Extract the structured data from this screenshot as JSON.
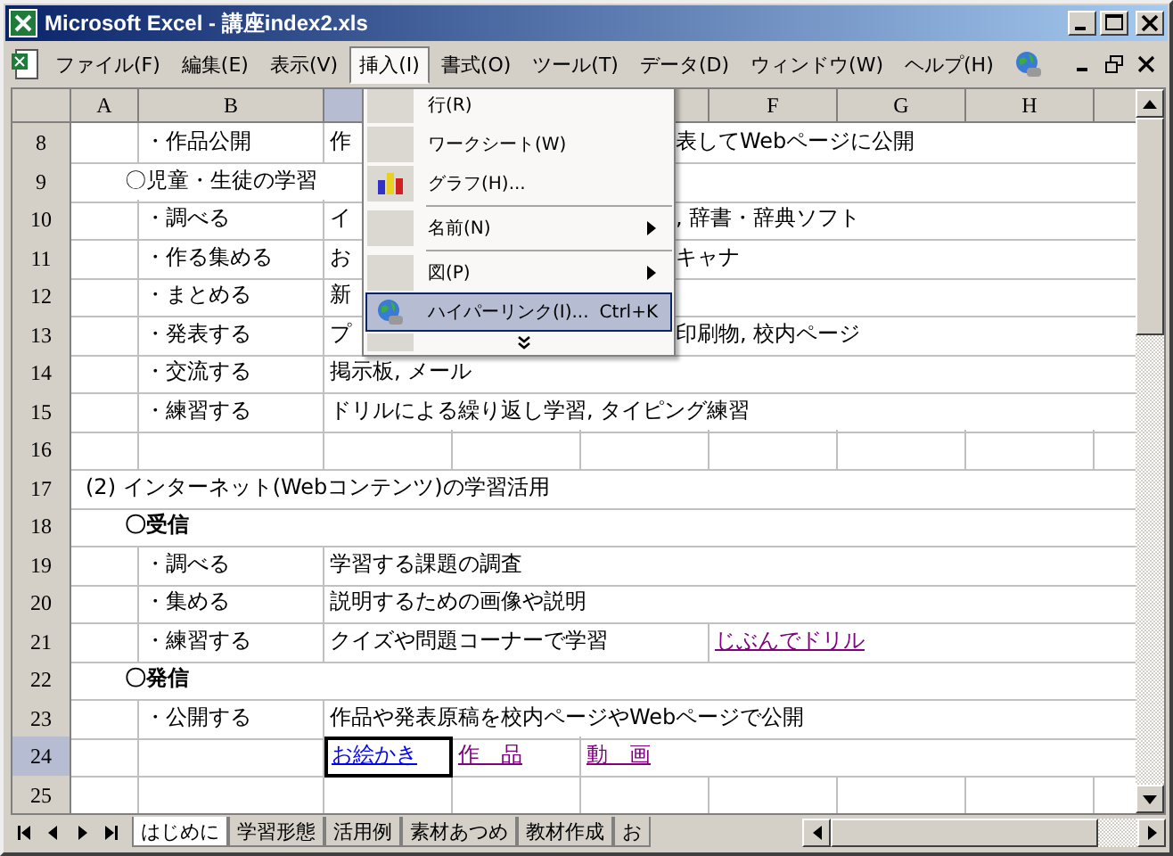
{
  "window": {
    "title": "Microsoft Excel - 講座index2.xls"
  },
  "menu_bar": [
    {
      "label": "ファイル(F)",
      "selected": false
    },
    {
      "label": "編集(E)",
      "selected": false
    },
    {
      "label": "表示(V)",
      "selected": false
    },
    {
      "label": "挿入(I)",
      "selected": true
    },
    {
      "label": "書式(O)",
      "selected": false
    },
    {
      "label": "ツール(T)",
      "selected": false
    },
    {
      "label": "データ(D)",
      "selected": false
    },
    {
      "label": "ウィンドウ(W)",
      "selected": false
    },
    {
      "label": "ヘルプ(H)",
      "selected": false
    }
  ],
  "columns": [
    {
      "label": "A"
    },
    {
      "label": "B"
    },
    {},
    {},
    {},
    {
      "label": "F"
    },
    {
      "label": "G"
    },
    {
      "label": "H"
    }
  ],
  "rows": [
    {
      "num": "8",
      "cells": {
        "b": {
          "kind": "plain",
          "text": "・作品公開"
        },
        "c": {
          "kind": "plain",
          "text": "作"
        },
        "e": {
          "kind": "tail",
          "text": "表してWebページに公開"
        }
      }
    },
    {
      "num": "9",
      "cells": {
        "a": {
          "kind": "heading",
          "bold": false,
          "text": "〇児童・生徒の学習"
        }
      }
    },
    {
      "num": "10",
      "cells": {
        "b": {
          "kind": "plain",
          "text": "・調べる"
        },
        "c": {
          "kind": "plain",
          "text": "イ"
        },
        "e": {
          "kind": "tail",
          "text": ", 辞書・辞典ソフト"
        }
      }
    },
    {
      "num": "11",
      "cells": {
        "b": {
          "kind": "plain",
          "text": "・作る集める"
        },
        "c": {
          "kind": "plain",
          "text": "お"
        },
        "e": {
          "kind": "tail",
          "text": "キャナ"
        }
      }
    },
    {
      "num": "12",
      "cells": {
        "b": {
          "kind": "plain",
          "text": "・まとめる"
        },
        "c": {
          "kind": "plain",
          "text": "新"
        }
      }
    },
    {
      "num": "13",
      "cells": {
        "b": {
          "kind": "plain",
          "text": "・発表する"
        },
        "c": {
          "kind": "plain",
          "text": "プ"
        },
        "e": {
          "kind": "tail",
          "text": "印刷物, 校内ページ"
        }
      }
    },
    {
      "num": "14",
      "cells": {
        "b": {
          "kind": "plain",
          "text": "・交流する"
        },
        "c": {
          "kind": "plain",
          "text": "掲示板, メール"
        }
      }
    },
    {
      "num": "15",
      "cells": {
        "b": {
          "kind": "plain",
          "text": "・練習する"
        },
        "c": {
          "kind": "plain",
          "text": "ドリルによる繰り返し学習, タイピング練習"
        }
      }
    },
    {
      "num": "16",
      "cells": {}
    },
    {
      "num": "17",
      "cells": {
        "a": {
          "kind": "title",
          "text": "(2) インターネット(Webコンテンツ)の学習活用"
        }
      }
    },
    {
      "num": "18",
      "cells": {
        "a": {
          "kind": "heading",
          "bold": true,
          "text": "〇受信"
        }
      }
    },
    {
      "num": "19",
      "cells": {
        "b": {
          "kind": "plain",
          "text": "・調べる"
        },
        "c": {
          "kind": "plain",
          "text": "学習する課題の調査"
        }
      }
    },
    {
      "num": "20",
      "cells": {
        "b": {
          "kind": "plain",
          "text": "・集める"
        },
        "c": {
          "kind": "plain",
          "text": "説明するための画像や説明"
        }
      }
    },
    {
      "num": "21",
      "cells": {
        "b": {
          "kind": "plain",
          "text": "・練習する"
        },
        "c": {
          "kind": "plain",
          "text": "クイズや問題コーナーで学習"
        },
        "f": {
          "kind": "link",
          "visited": true,
          "text": "じぶんでドリル"
        }
      }
    },
    {
      "num": "22",
      "cells": {
        "a": {
          "kind": "heading",
          "bold": true,
          "text": "〇発信"
        }
      }
    },
    {
      "num": "23",
      "cells": {
        "b": {
          "kind": "plain",
          "text": "・公開する"
        },
        "c": {
          "kind": "plain",
          "text": "作品や発表原稿を校内ページやWebページで公開"
        }
      }
    },
    {
      "num": "24",
      "cells": {
        "c": {
          "kind": "link",
          "visited": false,
          "selected": true,
          "text": "お絵かき"
        },
        "d": {
          "kind": "link",
          "visited": true,
          "text": "作　品"
        },
        "e": {
          "kind": "link",
          "visited": true,
          "text": "動　画"
        }
      }
    },
    {
      "num": "25",
      "cells": {}
    }
  ],
  "insert_menu": [
    {
      "kind": "plain",
      "label": "行(R)",
      "selected": false
    },
    {
      "kind": "plain",
      "label": "ワークシート(W)",
      "selected": false
    },
    {
      "kind": "chart",
      "label": "グラフ(H)...",
      "selected": false
    },
    {
      "kind": "plain",
      "label": "名前(N)",
      "submenu": true,
      "separator_before": true,
      "selected": false
    },
    {
      "kind": "plain",
      "label": "図(P)",
      "submenu": true,
      "separator_before": true,
      "selected": false
    },
    {
      "kind": "globe",
      "label": "ハイパーリンク(I)...",
      "shortcut": "Ctrl+K",
      "selected": true
    }
  ],
  "sheet_tabs": [
    {
      "label": "はじめに",
      "selected": true
    },
    {
      "label": "学習形態",
      "selected": false
    },
    {
      "label": "活用例",
      "selected": false
    },
    {
      "label": "素材あつめ",
      "selected": false
    },
    {
      "label": "教材作成",
      "selected": false
    },
    {
      "label": "お",
      "selected": false
    }
  ]
}
